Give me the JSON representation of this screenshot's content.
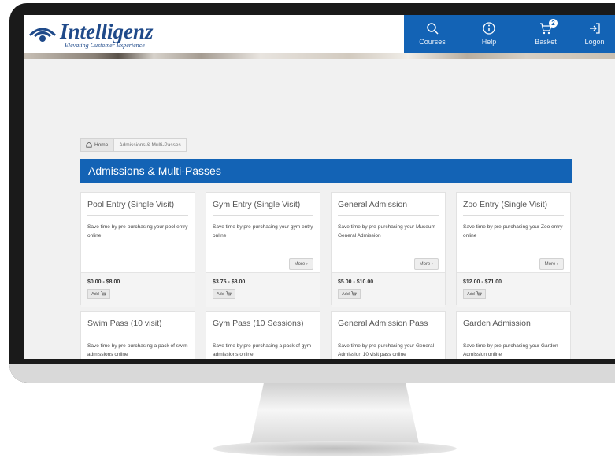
{
  "brand": {
    "name": "Intelligenz",
    "tagline": "Elevating Customer Experience"
  },
  "nav": {
    "items": [
      {
        "label": "Courses",
        "icon": "search-icon"
      },
      {
        "label": "Help",
        "icon": "info-icon"
      },
      {
        "label": "Basket",
        "icon": "cart-icon",
        "badge": "2"
      },
      {
        "label": "Logon",
        "icon": "login-icon"
      }
    ]
  },
  "breadcrumb": {
    "home": "Home",
    "current": "Admissions & Multi-Passes"
  },
  "section": {
    "title": "Admissions & Multi-Passes"
  },
  "cards": [
    {
      "title": "Pool Entry (Single Visit)",
      "desc": "Save time by pre-purchasing your pool entry online",
      "price": "$0.00 - $8.00",
      "add": "Add",
      "more": ""
    },
    {
      "title": "Gym Entry (Single Visit)",
      "desc": "Save time by pre-purchasing your gym entry online",
      "price": "$3.75 - $8.00",
      "add": "Add",
      "more": "More"
    },
    {
      "title": "General Admission",
      "desc": "Save time by pre-purchasing your Museum General Admission",
      "price": "$5.00 - $10.00",
      "add": "Add",
      "more": "More"
    },
    {
      "title": "Zoo Entry (Single Visit)",
      "desc": "Save time by pre-purchasing your Zoo entry online",
      "price": "$12.00 - $71.00",
      "add": "Add",
      "more": "More"
    },
    {
      "title": "Swim Pass (10 visit)",
      "desc": "Save time by pre-purchasing a pack of swim admissions online"
    },
    {
      "title": "Gym Pass (10 Sessions)",
      "desc": "Save time by pre-purchasing a pack of gym admissions online"
    },
    {
      "title": "General Admission Pass",
      "desc": "Save time by pre-purchasing your General Admission 10 visit pass online"
    },
    {
      "title": "Garden Admission",
      "desc": "Save time by pre-purchasing your Garden Admission online"
    }
  ],
  "colors": {
    "primary": "#1363b5",
    "brand_text": "#1f4a8a"
  }
}
